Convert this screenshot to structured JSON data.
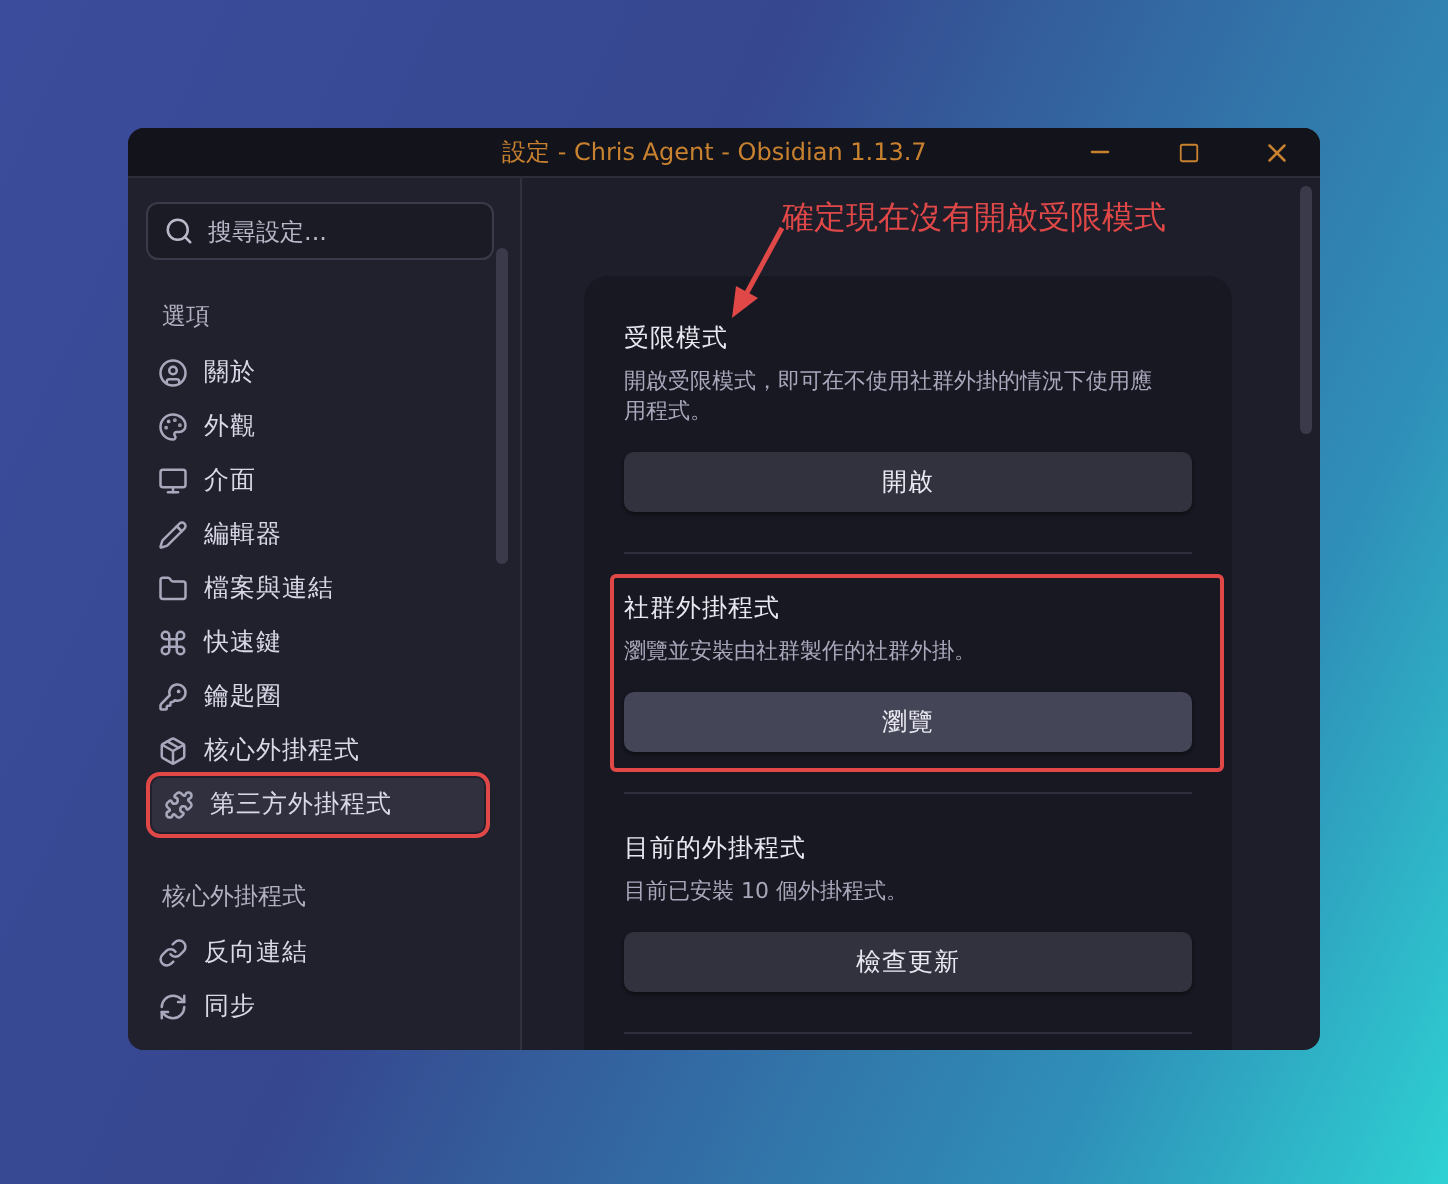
{
  "window": {
    "title": "設定 - Chris Agent - Obsidian 1.13.7"
  },
  "search": {
    "placeholder": "搜尋設定..."
  },
  "sidebar": {
    "groups": [
      {
        "heading": "選項",
        "items": [
          {
            "label": "關於",
            "selected": false,
            "highlighted": false
          },
          {
            "label": "外觀",
            "selected": false,
            "highlighted": false
          },
          {
            "label": "介面",
            "selected": false,
            "highlighted": false
          },
          {
            "label": "編輯器",
            "selected": false,
            "highlighted": false
          },
          {
            "label": "檔案與連結",
            "selected": false,
            "highlighted": false
          },
          {
            "label": "快速鍵",
            "selected": false,
            "highlighted": false
          },
          {
            "label": "鑰匙圈",
            "selected": false,
            "highlighted": false
          },
          {
            "label": "核心外掛程式",
            "selected": false,
            "highlighted": false
          },
          {
            "label": "第三方外掛程式",
            "selected": true,
            "highlighted": true
          }
        ]
      },
      {
        "heading": "核心外掛程式",
        "items": [
          {
            "label": "反向連結",
            "selected": false,
            "highlighted": false
          },
          {
            "label": "同步",
            "selected": false,
            "highlighted": false
          }
        ]
      }
    ]
  },
  "annotation": {
    "text": "確定現在沒有開啟受限模式"
  },
  "sections": [
    {
      "title": "受限模式",
      "description": "開啟受限模式，即可在不使用社群外掛的情況下使用應用程式。",
      "button": "開啟",
      "button_emphasized": false,
      "highlighted": false
    },
    {
      "title": "社群外掛程式",
      "description": "瀏覽並安裝由社群製作的社群外掛。",
      "button": "瀏覽",
      "button_emphasized": true,
      "highlighted": true
    },
    {
      "title": "目前的外掛程式",
      "description": "目前已安裝 10 個外掛程式。",
      "button": "檢查更新",
      "button_emphasized": false,
      "highlighted": false
    }
  ]
}
